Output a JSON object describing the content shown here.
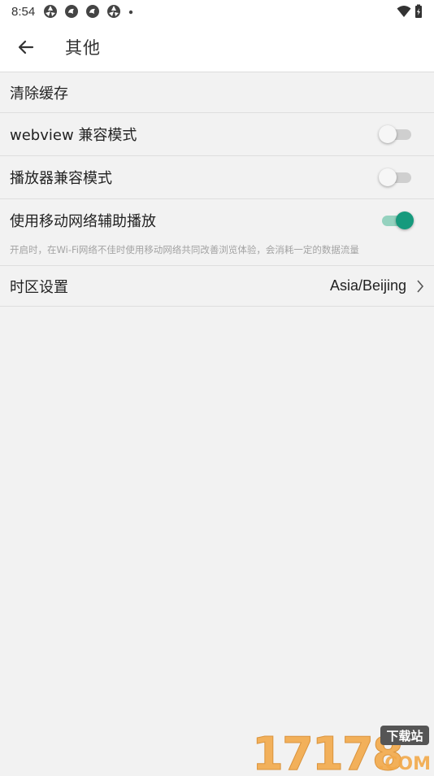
{
  "status_bar": {
    "time": "8:54"
  },
  "app_bar": {
    "title": "其他"
  },
  "settings": {
    "clear_cache": {
      "label": "清除缓存"
    },
    "webview_compat": {
      "label": "webview 兼容模式",
      "enabled": false
    },
    "player_compat": {
      "label": "播放器兼容模式",
      "enabled": false
    },
    "mobile_assist": {
      "label": "使用移动网络辅助播放",
      "description": "开启时，在Wi-Fi网络不佳时使用移动网络共同改善浏览体验，会消耗一定的数据流量",
      "enabled": true
    },
    "timezone": {
      "label": "时区设置",
      "value": "Asia/Beijing"
    }
  },
  "watermark": {
    "text": "17178",
    "badge": "下载站",
    "suffix": ".COM"
  },
  "colors": {
    "accent": "#169a7d",
    "accent_track": "#95d2bf",
    "background": "#f2f2f2",
    "watermark_orange": "#f2a94a"
  }
}
